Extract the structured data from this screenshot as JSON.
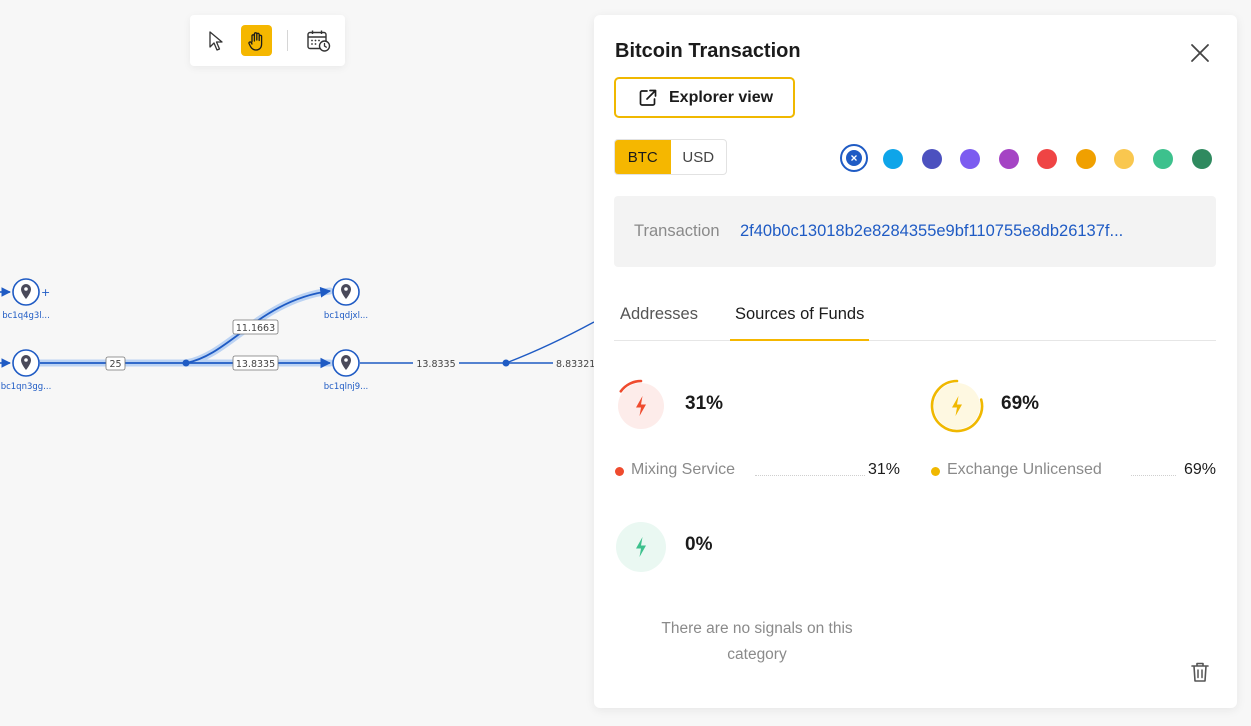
{
  "graph": {
    "nodes": [
      {
        "label": "bc1q4g3l...",
        "plus": "+"
      },
      {
        "label": "bc1qn3gg..."
      },
      {
        "label": "bc1qdjxl..."
      },
      {
        "label": "bc1qlnj9..."
      }
    ],
    "edges": [
      {
        "label": "25"
      },
      {
        "label": "11.1663"
      },
      {
        "label": "13.8335"
      },
      {
        "label": "13.8335"
      },
      {
        "label": "8.83321"
      }
    ]
  },
  "toolbar": {
    "tools": [
      {
        "icon": "cursor-icon",
        "active": false
      },
      {
        "icon": "hand-icon",
        "active": true
      },
      {
        "icon": "calendar-clock-icon",
        "active": false
      }
    ]
  },
  "panel": {
    "title": "Bitcoin Transaction",
    "explorer_label": "Explorer view",
    "currency": {
      "options": [
        "BTC",
        "USD"
      ],
      "selected": "BTC"
    },
    "colors": [
      "#1f5bc4",
      "#0ea5e9",
      "#4c51bf",
      "#7c5cf0",
      "#a544c4",
      "#ef4444",
      "#f0a000",
      "#f9c74f",
      "#3dc18d",
      "#2f8a5f"
    ],
    "selected_color": "#1f5bc4",
    "transaction": {
      "label": "Transaction",
      "hash": "2f40b0c13018b2e8284355e9bf110755e8db26137f..."
    },
    "tabs": [
      "Addresses",
      "Sources of Funds"
    ],
    "active_tab": "Sources of Funds",
    "funds": [
      {
        "percent": "31%",
        "name": "Mixing Service",
        "value": "31%",
        "color": "#ef4b2e",
        "bg": "#fdecea"
      },
      {
        "percent": "69%",
        "name": "Exchange Unlicensed",
        "value": "69%",
        "color": "#f0b800",
        "bg": "#fef8e1"
      },
      {
        "percent": "0%",
        "color": "#3dc18d",
        "bg": "#eaf8f2"
      }
    ],
    "no_signals": "There are no signals on this category"
  }
}
